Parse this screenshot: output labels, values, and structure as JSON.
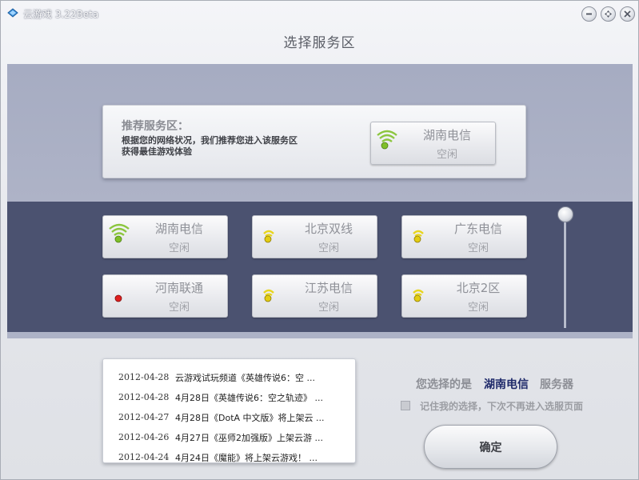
{
  "window": {
    "title": "云游戏 3.22Beta"
  },
  "page_title": "选择服务区",
  "recommend": {
    "heading": "推荐服务区：",
    "desc_line1": "根据您的网络状况，我们推荐您进入该服务区",
    "desc_line2": "获得最佳游戏体验",
    "server": {
      "name": "湖南电信",
      "status": "空闲",
      "signal": "green"
    }
  },
  "servers": [
    {
      "name": "湖南电信",
      "status": "空闲",
      "signal": "green"
    },
    {
      "name": "北京双线",
      "status": "空闲",
      "signal": "yellow"
    },
    {
      "name": "广东电信",
      "status": "空闲",
      "signal": "yellow"
    },
    {
      "name": "河南联通",
      "status": "空闲",
      "signal": "red"
    },
    {
      "name": "江苏电信",
      "status": "空闲",
      "signal": "yellow"
    },
    {
      "name": "北京2区",
      "status": "空闲",
      "signal": "yellow"
    }
  ],
  "news": [
    {
      "date": "2012-04-28",
      "text": "云游戏试玩频道《英雄传说6：空 ..."
    },
    {
      "date": "2012-04-28",
      "text": "4月28日《英雄传说6：空之轨迹》 ..."
    },
    {
      "date": "2012-04-27",
      "text": "4月28日《DotA 中文版》将上架云 ..."
    },
    {
      "date": "2012-04-26",
      "text": "4月27日《巫师2加强版》上架云游 ..."
    },
    {
      "date": "2012-04-24",
      "text": "4月24日《魔能》将上架云游戏！ ..."
    }
  ],
  "selection": {
    "prefix": "您选择的是",
    "server": "湖南电信",
    "suffix": "服务器",
    "remember_label": "记住我的选择，下次不再进入选服页面",
    "confirm_label": "确定"
  },
  "colors": {
    "signal_green": "#8cc63f",
    "signal_yellow": "#e8d51d",
    "signal_red": "#e02020",
    "dark_panel": "#4b5270",
    "selected_text": "#1f2a6a"
  },
  "icons": {
    "app": "cloud-logo-icon",
    "minimize": "minimize-icon",
    "maximize": "maximize-icon",
    "close": "close-icon",
    "signal": "wifi-signal-icon"
  }
}
